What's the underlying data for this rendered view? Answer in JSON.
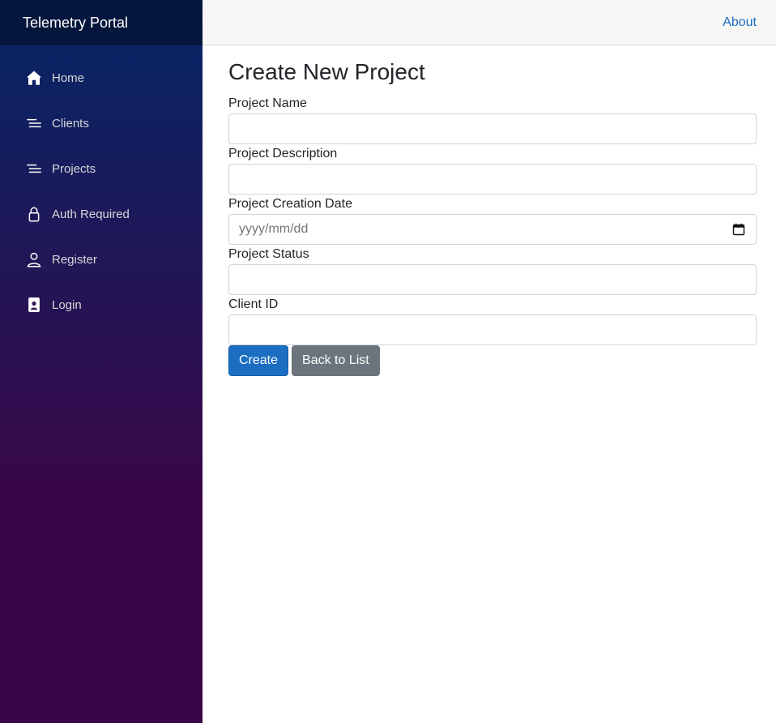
{
  "brand": "Telemetry Portal",
  "nav": {
    "items": [
      {
        "label": "Home",
        "icon": "home-icon"
      },
      {
        "label": "Clients",
        "icon": "list-icon"
      },
      {
        "label": "Projects",
        "icon": "list-icon"
      },
      {
        "label": "Auth Required",
        "icon": "lock-icon"
      },
      {
        "label": "Register",
        "icon": "person-icon"
      },
      {
        "label": "Login",
        "icon": "id-badge-icon"
      }
    ]
  },
  "top_row": {
    "about": "About"
  },
  "page": {
    "title": "Create New Project",
    "fields": {
      "name": {
        "label": "Project Name",
        "value": ""
      },
      "description": {
        "label": "Project Description",
        "value": ""
      },
      "creation_date": {
        "label": "Project Creation Date",
        "placeholder": "yyyy/mm/dd"
      },
      "status": {
        "label": "Project Status",
        "value": ""
      },
      "client_id": {
        "label": "Client ID",
        "value": ""
      }
    },
    "buttons": {
      "create": "Create",
      "back": "Back to List"
    }
  },
  "colors": {
    "sidebar_top": "#052767",
    "sidebar_bottom": "#3a0647",
    "primary": "#1b6ec2",
    "secondary": "#6c757d"
  }
}
